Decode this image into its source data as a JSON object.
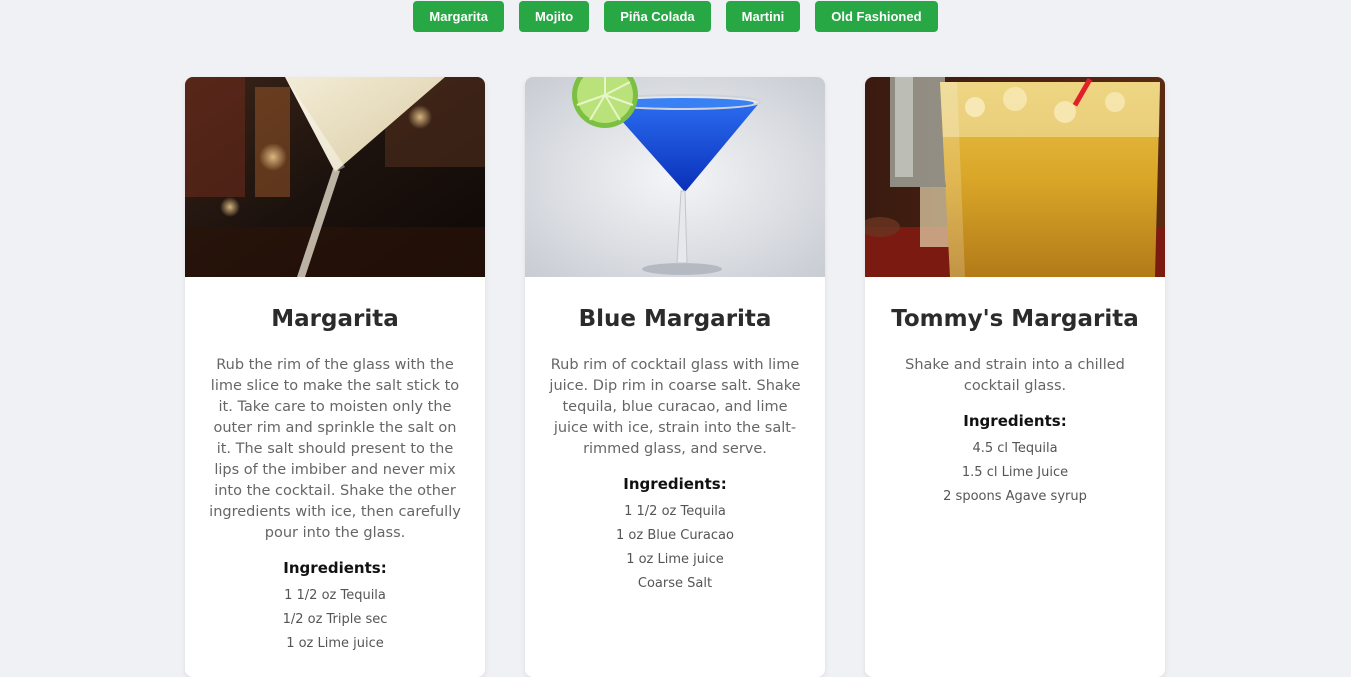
{
  "filters": [
    {
      "label": "Margarita"
    },
    {
      "label": "Mojito"
    },
    {
      "label": "Piña Colada"
    },
    {
      "label": "Martini"
    },
    {
      "label": "Old Fashioned"
    }
  ],
  "colors": {
    "button": "#28a745",
    "background": "#f0f1f5",
    "card": "#ffffff"
  },
  "cards": [
    {
      "title": "Margarita",
      "description": "Rub the rim of the glass with the lime slice to make the salt stick to it. Take care to moisten only the outer rim and sprinkle the salt on it. The salt should present to the lips of the imbiber and never mix into the cocktail. Shake the other ingredients with ice, then carefully pour into the glass.",
      "ingredients_heading": "Ingredients:",
      "ingredients": [
        "1 1/2 oz Tequila",
        "1/2 oz Triple sec",
        "1 oz Lime juice"
      ]
    },
    {
      "title": "Blue Margarita",
      "description": "Rub rim of cocktail glass with lime juice. Dip rim in coarse salt. Shake tequila, blue curacao, and lime juice with ice, strain into the salt-rimmed glass, and serve.",
      "ingredients_heading": "Ingredients:",
      "ingredients": [
        "1 1/2 oz Tequila",
        "1 oz Blue Curacao",
        "1 oz Lime juice",
        "Coarse Salt"
      ]
    },
    {
      "title": "Tommy's Margarita",
      "description": "Shake and strain into a chilled cocktail glass.",
      "ingredients_heading": "Ingredients:",
      "ingredients": [
        "4.5 cl Tequila",
        "1.5 cl Lime Juice",
        "2 spoons Agave syrup"
      ]
    }
  ]
}
